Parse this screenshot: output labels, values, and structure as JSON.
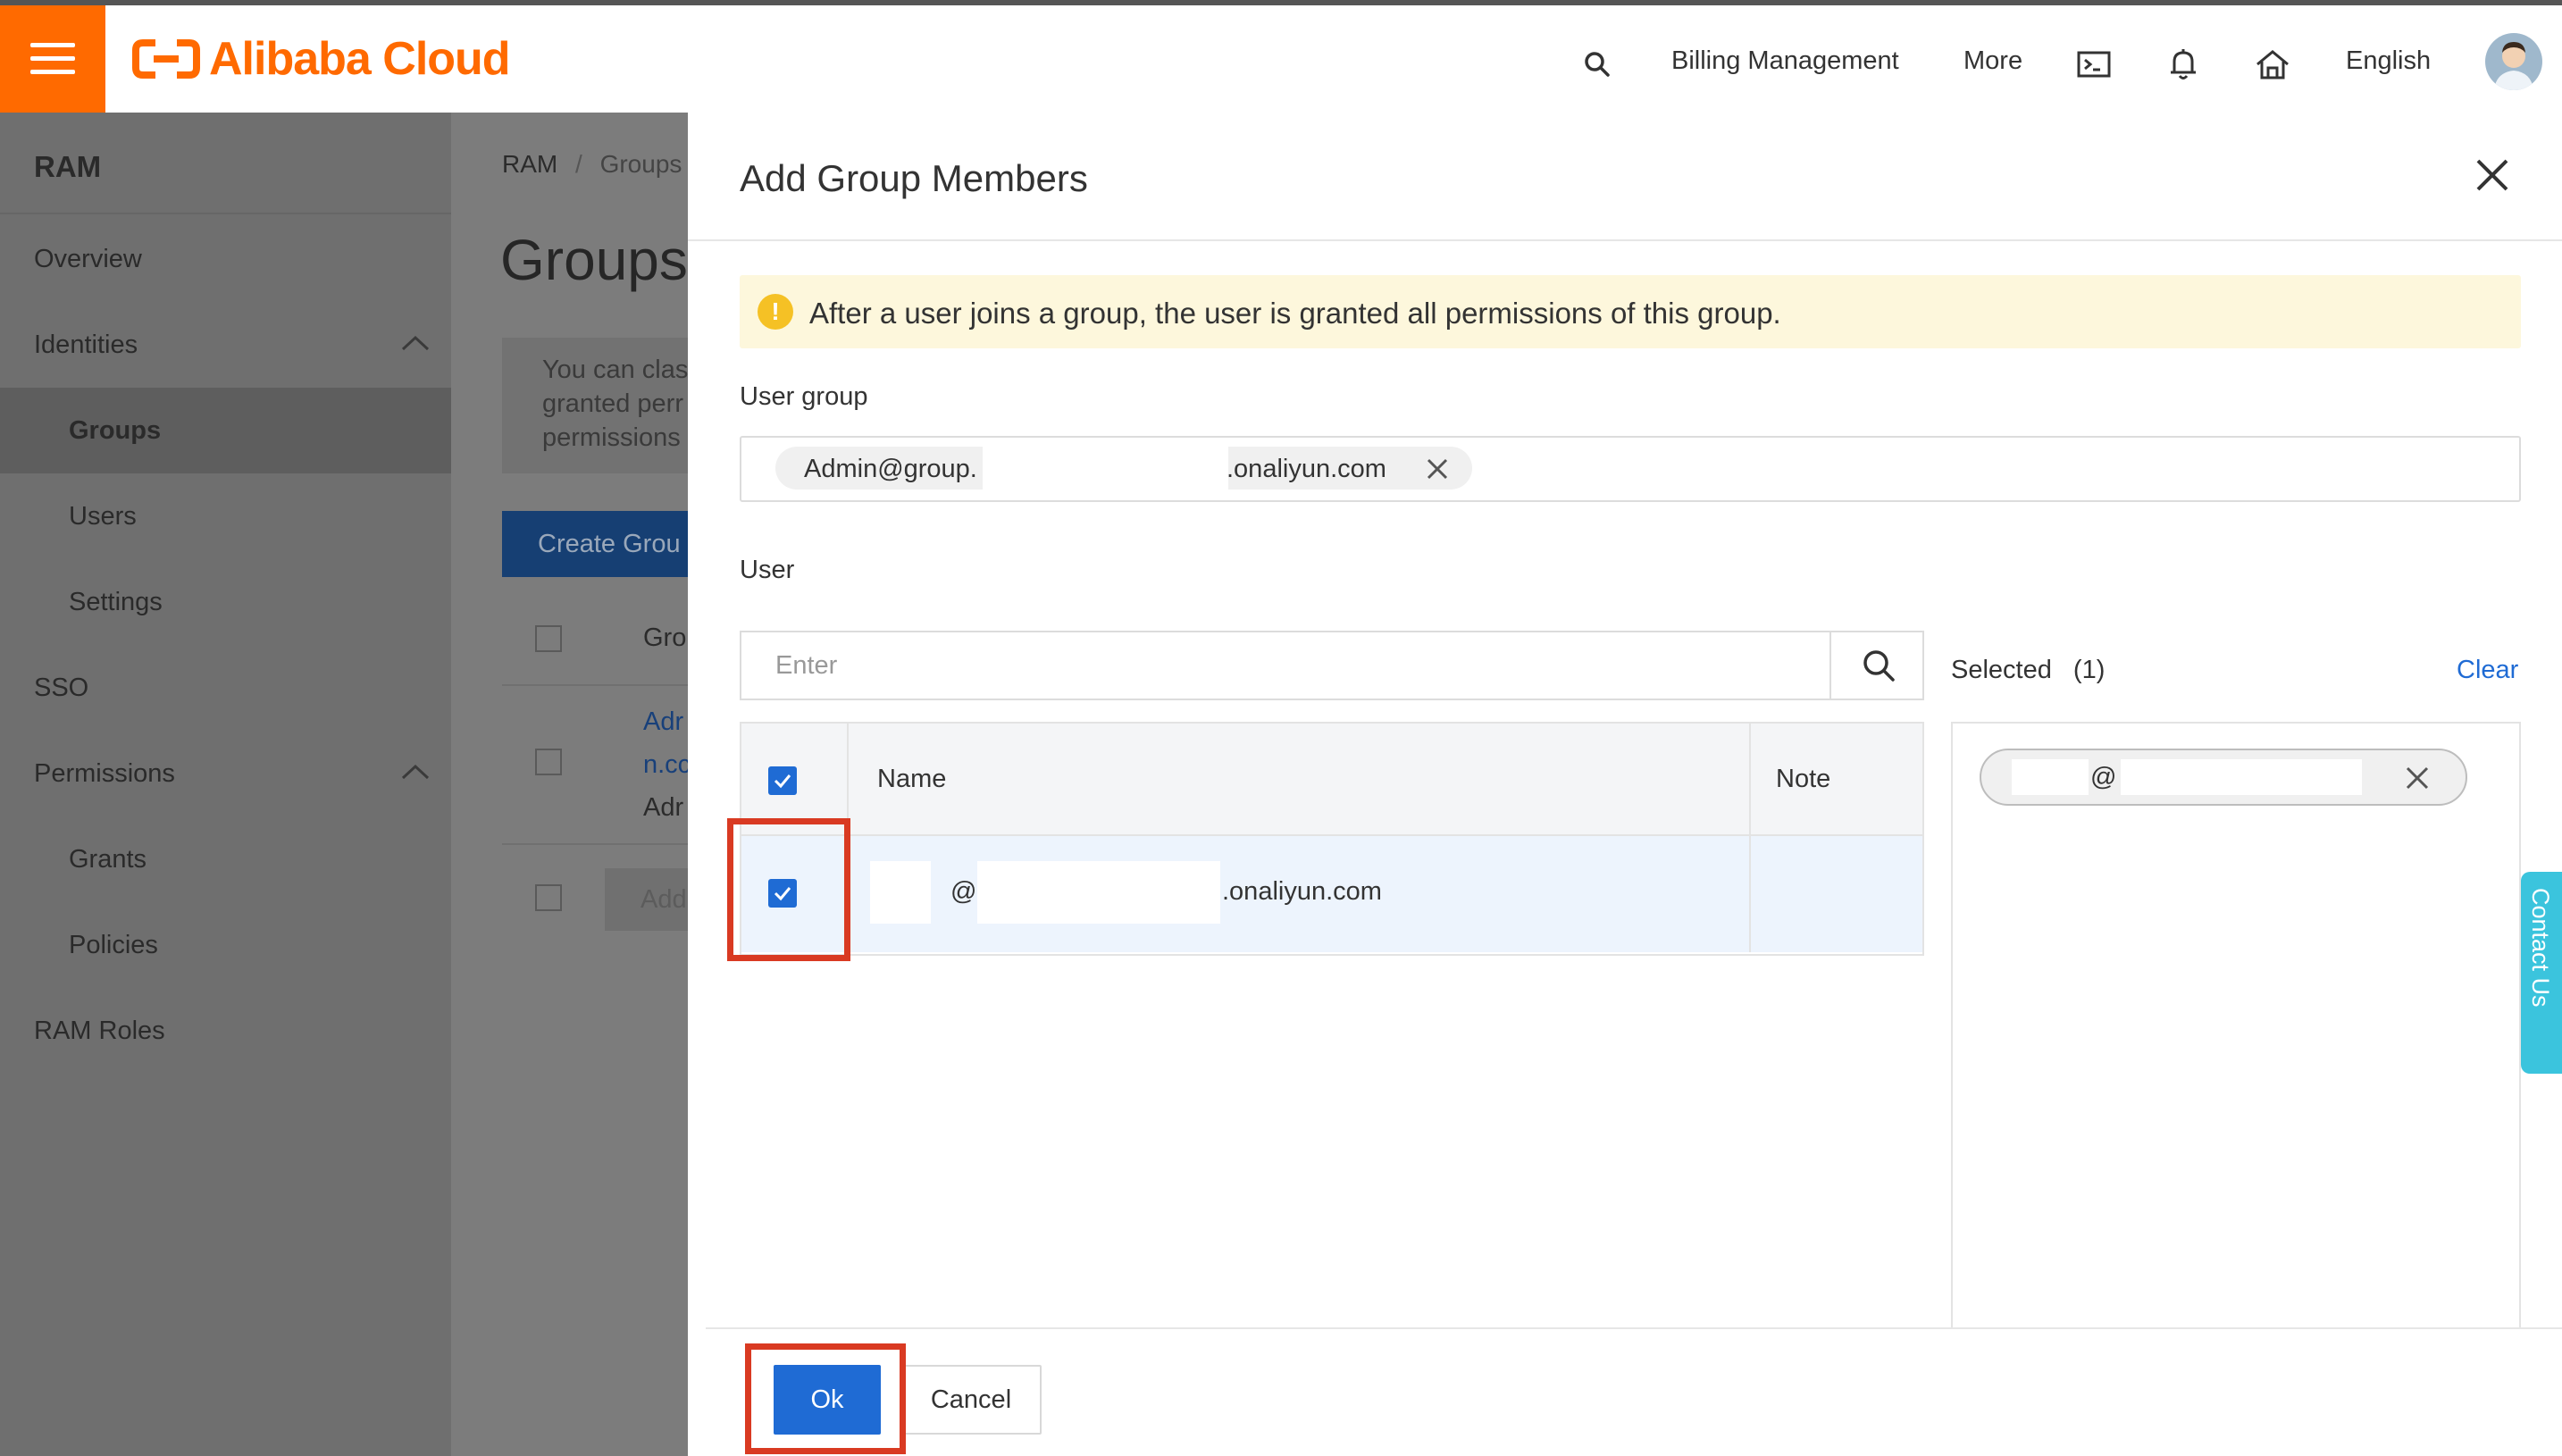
{
  "topbar": {
    "logo_text": "Alibaba Cloud",
    "billing": "Billing Management",
    "more": "More",
    "language": "English",
    "brand_color": "#ff6a00"
  },
  "sidebar": {
    "title": "RAM",
    "overview": "Overview",
    "identities": "Identities",
    "groups": "Groups",
    "users": "Users",
    "settings": "Settings",
    "sso": "SSO",
    "permissions": "Permissions",
    "grants": "Grants",
    "policies": "Policies",
    "ram_roles": "RAM Roles"
  },
  "main": {
    "breadcrumb_root": "RAM",
    "breadcrumb_sep": "/",
    "breadcrumb_current": "Groups",
    "page_title": "Groups",
    "info_line1": "You can clas",
    "info_line2": "granted perr",
    "info_line3": "permissions",
    "create_button": "Create Grou",
    "col_group": "Gro",
    "row_link1": "Adr",
    "row_link2": "n.cc",
    "row_text": "Adr",
    "add_button": "Add"
  },
  "modal": {
    "title": "Add Group Members",
    "alert": "After a user joins a group, the user is granted all permissions of this group.",
    "user_group_label": "User group",
    "group_tag_prefix": "Admin@group.",
    "group_tag_suffix": ".onaliyun.com",
    "user_label": "User",
    "search_placeholder": "Enter",
    "col_name": "Name",
    "col_note": "Note",
    "row_at": "@",
    "row_domain": ".onaliyun.com",
    "selected_label": "Selected",
    "selected_count": "(1)",
    "clear": "Clear",
    "selected_tag_at": "@",
    "ok": "Ok",
    "cancel": "Cancel",
    "accent_color": "#1f6bd4",
    "highlight_color": "#d93a22"
  },
  "contact": {
    "label": "Contact Us"
  }
}
